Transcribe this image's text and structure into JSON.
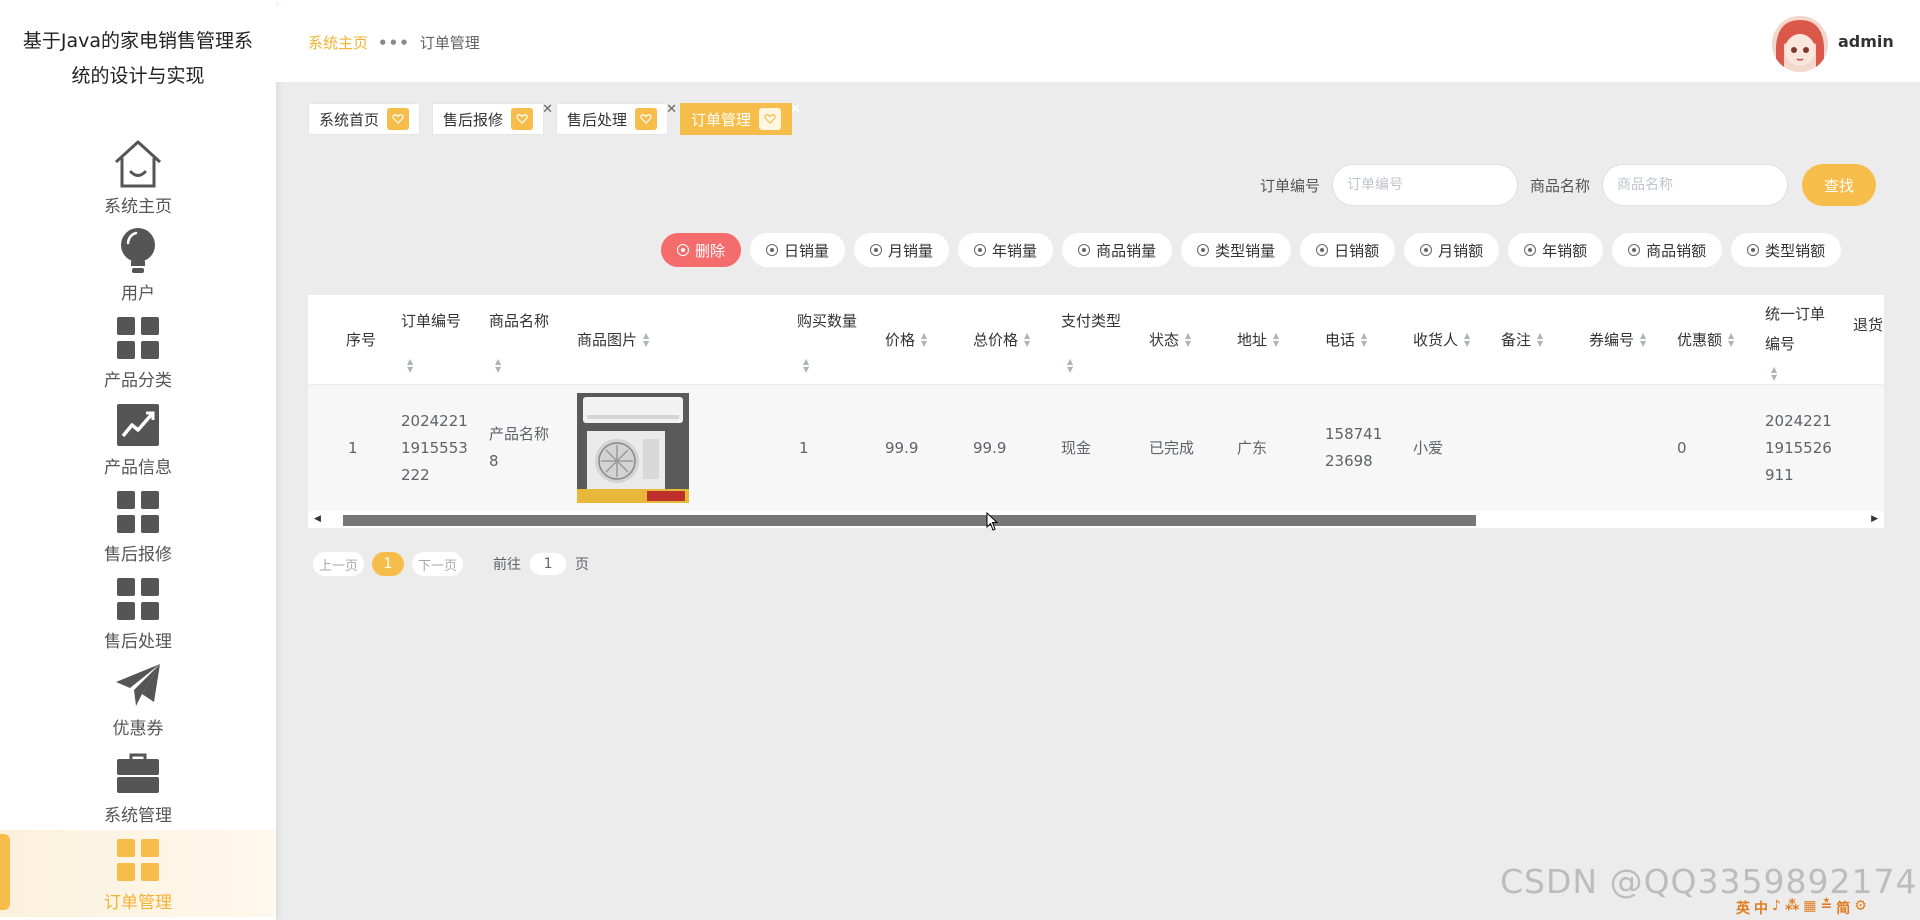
{
  "app": {
    "title": "基于Java的家电销售管理系统的设计与实现"
  },
  "sidebar": {
    "items": [
      {
        "label": "系统主页",
        "icon": "home-icon"
      },
      {
        "label": "用户",
        "icon": "lightbulb-icon"
      },
      {
        "label": "产品分类",
        "icon": "grid-icon"
      },
      {
        "label": "产品信息",
        "icon": "chart-icon"
      },
      {
        "label": "售后报修",
        "icon": "grid-icon"
      },
      {
        "label": "售后处理",
        "icon": "grid-icon"
      },
      {
        "label": "优惠券",
        "icon": "paper-plane-icon"
      },
      {
        "label": "系统管理",
        "icon": "toolbox-icon"
      },
      {
        "label": "订单管理",
        "icon": "grid-icon",
        "active": true
      }
    ]
  },
  "header": {
    "breadcrumb": {
      "home": "系统主页",
      "separator": "•••",
      "current": "订单管理"
    },
    "user": "admin"
  },
  "tags": [
    {
      "label": "系统首页",
      "closable": false
    },
    {
      "label": "售后报修",
      "closable": true
    },
    {
      "label": "售后处理",
      "closable": true
    },
    {
      "label": "订单管理",
      "closable": true,
      "active": true
    }
  ],
  "search": {
    "order_no_label": "订单编号",
    "order_no_placeholder": "订单编号",
    "product_name_label": "商品名称",
    "product_name_placeholder": "商品名称",
    "button": "查找"
  },
  "actions": [
    "删除",
    "日销量",
    "月销量",
    "年销量",
    "商品销量",
    "类型销量",
    "日销额",
    "月销额",
    "年销额",
    "商品销额",
    "类型销额"
  ],
  "table": {
    "columns": [
      "序号",
      "订单编号",
      "商品名称",
      "商品图片",
      "购买数量",
      "价格",
      "总价格",
      "支付类型",
      "状态",
      "地址",
      "电话",
      "收货人",
      "备注",
      "券编号",
      "优惠额",
      "统一订单编号",
      "退货"
    ],
    "rows": [
      {
        "index": "1",
        "order_no": "20242211915553222",
        "product_name": "产品名称8",
        "quantity": "1",
        "price": "99.9",
        "total": "99.9",
        "pay_type": "现金",
        "status": "已完成",
        "address": "广东",
        "phone": "15874123698",
        "receiver": "小爱",
        "remark": "",
        "coupon_no": "",
        "discount": "0",
        "unified_order_no": "20242211915526911"
      }
    ]
  },
  "pager": {
    "prev": "上一页",
    "page": "1",
    "next": "下一页",
    "goto": "前往",
    "goto_value": "1",
    "suffix": "页"
  },
  "watermark": "CSDN @QQ3359892174",
  "tray": [
    "英",
    "中",
    "♪",
    "⁂",
    "▦",
    "≛",
    "简",
    "⚙"
  ],
  "colors": {
    "accent": "#f7bd4a",
    "danger": "#f56c6c",
    "bg": "#ececec"
  }
}
